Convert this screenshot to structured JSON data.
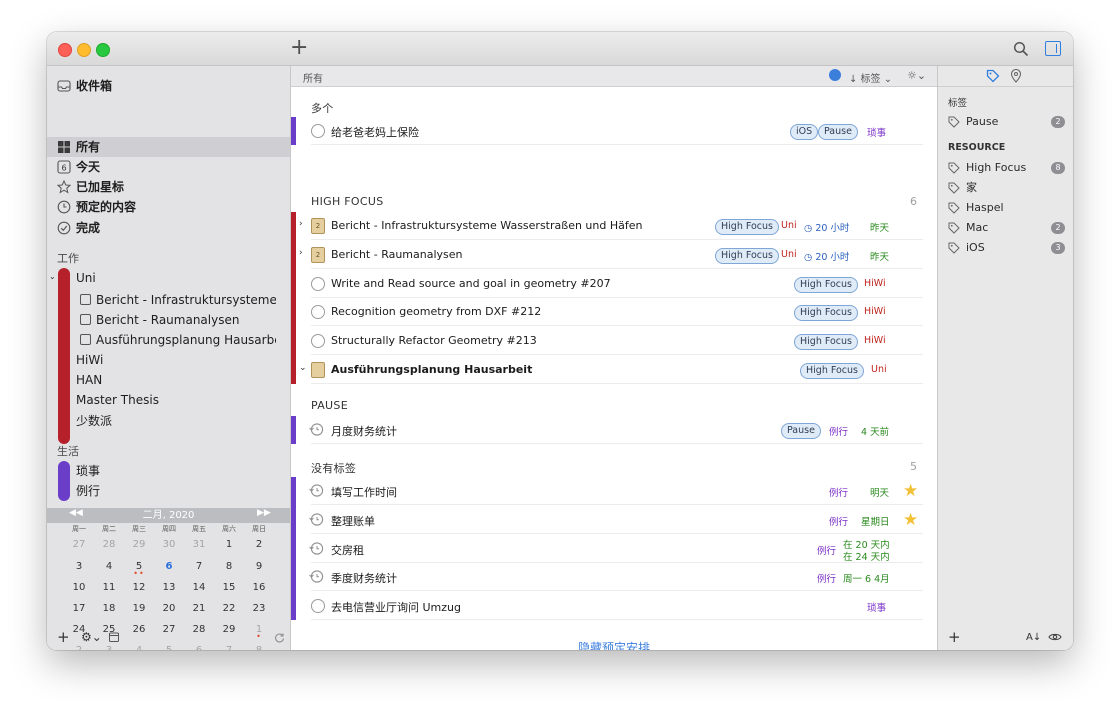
{
  "toolbar": {
    "add_label": "+"
  },
  "sidebar": {
    "inbox": "收件箱",
    "all": "所有",
    "today": "今天",
    "today_num": "6",
    "starred": "已加星标",
    "scheduled": "预定的内容",
    "completed": "完成",
    "work_section": "工作",
    "uni": "Uni",
    "uni_projects": [
      "Bericht - Infrastruktursysteme Wasserstraßen und Häfen",
      "Bericht - Raumanalysen",
      "Ausführungsplanung Hausarbeit"
    ],
    "work_areas": [
      "HiWi",
      "HAN",
      "Master Thesis",
      "少数派"
    ],
    "life_section": "生活",
    "life_areas": [
      "琐事",
      "例行"
    ]
  },
  "calendar": {
    "month": "二月, 2020",
    "prev": "◀◀",
    "next": "▶▶",
    "weekdays": [
      "周一",
      "周二",
      "周三",
      "周四",
      "周五",
      "周六",
      "周日"
    ],
    "weeks": [
      [
        "27",
        "28",
        "29",
        "30",
        "31",
        "1",
        "2"
      ],
      [
        "3",
        "4",
        "5",
        "6",
        "7",
        "8",
        "9"
      ],
      [
        "10",
        "11",
        "12",
        "13",
        "14",
        "15",
        "16"
      ],
      [
        "17",
        "18",
        "19",
        "20",
        "21",
        "22",
        "23"
      ],
      [
        "24",
        "25",
        "26",
        "27",
        "28",
        "29",
        "1"
      ],
      [
        "2",
        "3",
        "4",
        "5",
        "6",
        "7",
        "8"
      ]
    ]
  },
  "main": {
    "path": "所有",
    "sort_label": "↓ 标签",
    "groups": {
      "multi": {
        "title": "多个"
      },
      "high_focus": {
        "title": "HIGH FOCUS",
        "count": "6"
      },
      "pause": {
        "title": "PAUSE"
      },
      "untagged": {
        "title": "没有标签",
        "count": "5"
      }
    },
    "tasks": [
      {
        "title": "给老爸老妈上保险",
        "tags": [
          "iOS",
          "Pause"
        ],
        "project": "琐事"
      },
      {
        "title": "Bericht - Infrastruktursysteme Wasserstraßen und Häfen",
        "tag": "High Focus",
        "project": "Uni",
        "duration": "20 小时",
        "due": "昨天",
        "pj_num": "2"
      },
      {
        "title": "Bericht - Raumanalysen",
        "tag": "High Focus",
        "project": "Uni",
        "duration": "20 小时",
        "due": "昨天",
        "pj_num": "2"
      },
      {
        "title": "Write and Read source and goal in geometry #207",
        "tag": "High Focus",
        "project": "HiWi"
      },
      {
        "title": "Recognition geometry from DXF #212",
        "tag": "High Focus",
        "project": "HiWi"
      },
      {
        "title": "Structurally Refactor Geometry #213",
        "tag": "High Focus",
        "project": "HiWi"
      },
      {
        "title": "Ausführungsplanung Hausarbeit",
        "tag": "High Focus",
        "project": "Uni"
      },
      {
        "title": "月度财务统计",
        "tag": "Pause",
        "project": "例行",
        "due": "4 天前"
      },
      {
        "title": "填写工作时间",
        "project": "例行",
        "due": "明天"
      },
      {
        "title": "整理账单",
        "project": "例行",
        "due": "星期日"
      },
      {
        "title": "交房租",
        "project": "例行",
        "due": "在 20 天内",
        "due2": "在 24 天内"
      },
      {
        "title": "季度财务统计",
        "project": "例行",
        "due": "周一 6 4月"
      },
      {
        "title": "去电信营业厅询问 Umzug",
        "project": "琐事"
      }
    ],
    "hide_link": "隐藏预定安排"
  },
  "right": {
    "tags_section": "标签",
    "resource_section": "RESOURCE",
    "pause": {
      "label": "Pause",
      "count": "2"
    },
    "items": [
      {
        "label": "High Focus",
        "count": "8"
      },
      {
        "label": "家",
        "count": ""
      },
      {
        "label": "Haspel",
        "count": ""
      },
      {
        "label": "Mac",
        "count": "2"
      },
      {
        "label": "iOS",
        "count": "3"
      }
    ],
    "sort_label": "A↓"
  },
  "colors": {
    "red_bar": "#b6202a",
    "purple_bar": "#6a3ec9",
    "accent": "#3d7fe0"
  }
}
